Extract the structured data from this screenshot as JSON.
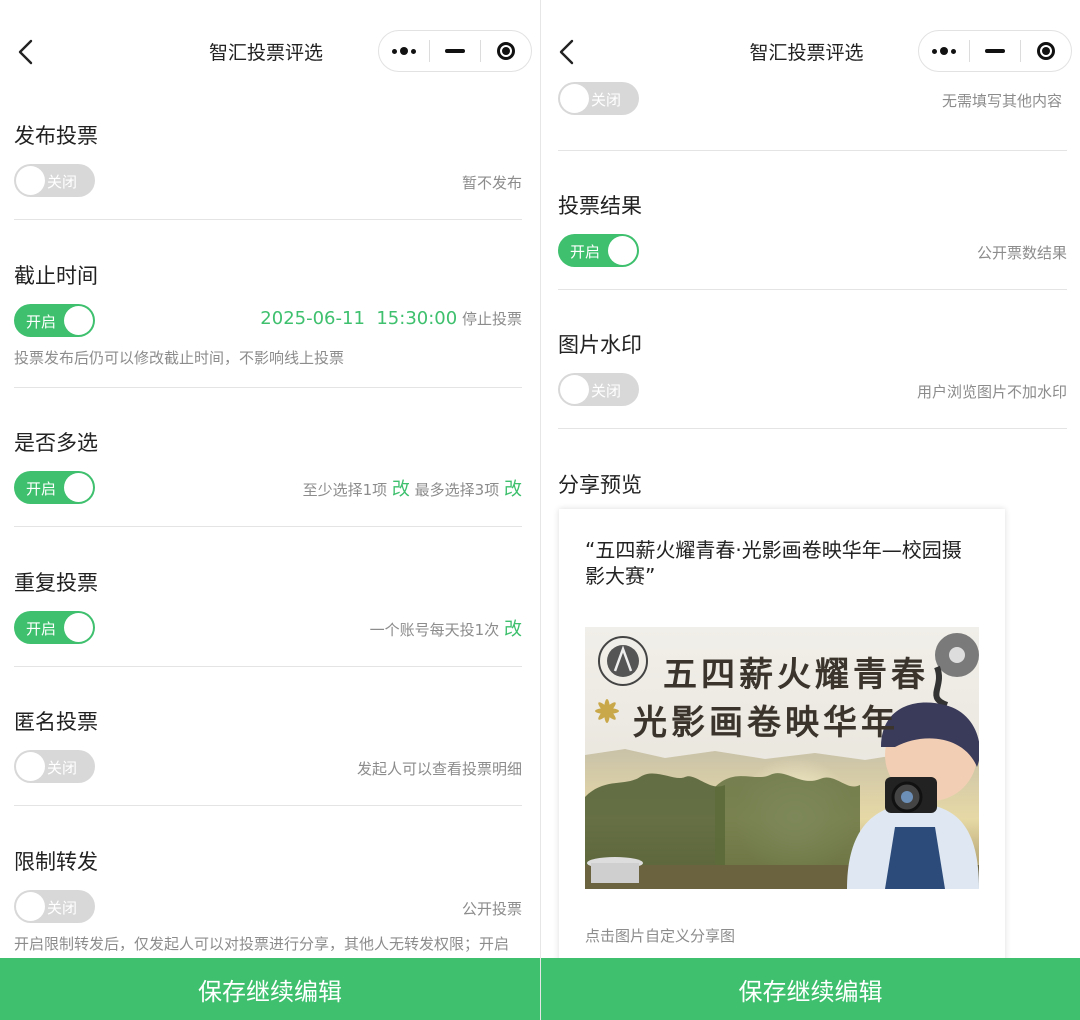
{
  "colors": {
    "accent": "#3ec06e",
    "toggle_off": "#d8d8d8",
    "muted_text": "#8c8c8c"
  },
  "nav": {
    "title": "智汇投票评选",
    "back_icon": "chevron-left-icon",
    "capsule_icons": [
      "more-dots-icon",
      "minimize-icon",
      "close-target-icon"
    ]
  },
  "left": {
    "sections": {
      "publish": {
        "title": "发布投票",
        "toggle": "关闭",
        "right": "暂不发布"
      },
      "deadline": {
        "title": "截止时间",
        "toggle": "开启",
        "date": "2025-06-11  15:30:00",
        "suffix": "停止投票",
        "hint": "投票发布后仍可以修改截止时间，不影响线上投票"
      },
      "multi": {
        "title": "是否多选",
        "toggle": "开启",
        "min_text": "至少选择1项",
        "change1": "改",
        "max_text": "最多选择3项",
        "change2": "改"
      },
      "repeat": {
        "title": "重复投票",
        "toggle": "开启",
        "right": "一个账号每天投1次",
        "change": "改"
      },
      "anonymous": {
        "title": "匿名投票",
        "toggle": "关闭",
        "right": "发起人可以查看投票明细"
      },
      "limit_share": {
        "title": "限制转发",
        "toggle": "关闭",
        "right": "公开投票",
        "hint": "开启限制转发后，仅发起人可以对投票进行分享，其他人无转发权限；开启限制转发后，发起人需要重新分享投票链接，并且无法生成二维码"
      }
    },
    "bottom_button": "保存继续编辑"
  },
  "right": {
    "top_row": {
      "toggle": "关闭",
      "right": "无需填写其他内容"
    },
    "sections": {
      "result": {
        "title": "投票结果",
        "toggle": "开启",
        "right": "公开票数结果"
      },
      "watermark": {
        "title": "图片水印",
        "toggle": "关闭",
        "right": "用户浏览图片不加水印"
      },
      "share": {
        "title": "分享预览",
        "card_title": "“五四薪火耀青春·光影画卷映华年—校园摄影大赛”",
        "poster_line1": "五四薪火耀青春",
        "poster_line2": "光影画卷映华年",
        "hint": "点击图片自定义分享图"
      }
    },
    "bottom_button": "保存继续编辑"
  }
}
